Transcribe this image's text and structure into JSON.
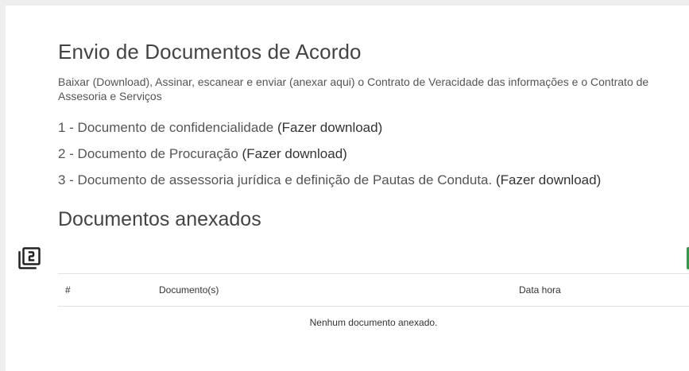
{
  "page": {
    "title": "Envio de Documentos de Acordo",
    "intro_line1": "Baixar (Download), Assinar, escanear e enviar (anexar aqui) o Contrato de Veracidade das informações e o Contrato de",
    "intro_line2": "Assesoria e Serviços"
  },
  "documents": [
    {
      "label": "1 - Documento de confidencialidade",
      "link": "(Fazer download)"
    },
    {
      "label": "2 - Documento de Procuração",
      "link": "(Fazer download)"
    },
    {
      "label": "3 - Documento de assessoria jurídica e definição de Pautas de Conduta.",
      "link": "(Fazer download)"
    }
  ],
  "attachments": {
    "title": "Documentos anexados",
    "icon": "filter-2-icon",
    "columns": [
      "#",
      "Documento(s)",
      "Data hora"
    ],
    "empty_message": "Nenhum documento anexado."
  },
  "colors": {
    "background": "#eeeeee",
    "card": "#ffffff",
    "accent_green": "#2e9a4a"
  }
}
